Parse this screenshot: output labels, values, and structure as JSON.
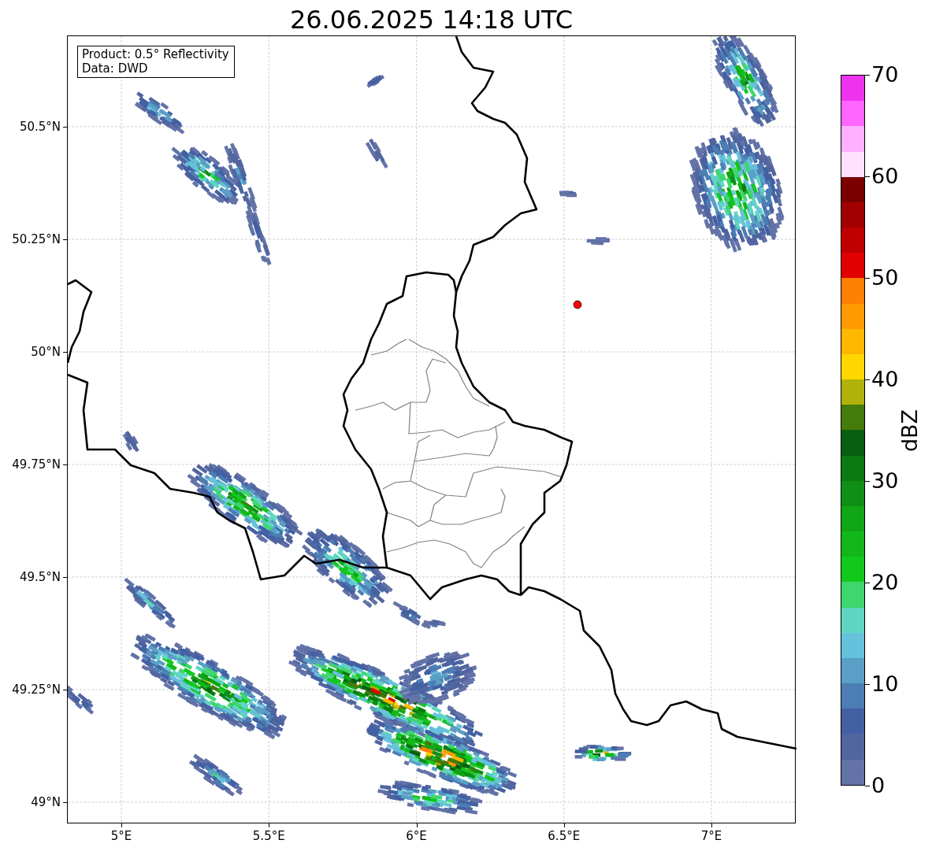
{
  "title": "26.06.2025 14:18 UTC",
  "info_box": [
    "Product: 0.5° Reflectivity",
    "Data: DWD"
  ],
  "y_ticks": [
    "50.5°N",
    "50.25°N",
    "50°N",
    "49.75°N",
    "49.5°N",
    "49.25°N",
    "49°N"
  ],
  "x_ticks": [
    "5°E",
    "5.5°E",
    "6°E",
    "6.5°E",
    "7°E"
  ],
  "colorbar": {
    "label": "dBZ",
    "ticks": [
      "70",
      "60",
      "50",
      "40",
      "30",
      "20",
      "10",
      "0"
    ],
    "colors": [
      {
        "color": "#ee33ee"
      },
      {
        "color": "#ff66ff"
      },
      {
        "color": "#ffb0ff"
      },
      {
        "color": "#ffe0ff"
      },
      {
        "color": "#7a0000"
      },
      {
        "color": "#a20000"
      },
      {
        "color": "#c00000"
      },
      {
        "color": "#e10000"
      },
      {
        "color": "#ff7f00"
      },
      {
        "color": "#ff9a00"
      },
      {
        "color": "#ffb700"
      },
      {
        "color": "#ffd700"
      },
      {
        "color": "#b1b209"
      },
      {
        "color": "#457a0c"
      },
      {
        "color": "#066010"
      },
      {
        "color": "#0b7a10"
      },
      {
        "color": "#0f8f15"
      },
      {
        "color": "#10a616"
      },
      {
        "color": "#12b81a"
      },
      {
        "color": "#12c81b"
      },
      {
        "color": "#3ed66e"
      },
      {
        "color": "#5fd5c3"
      },
      {
        "color": "#66c1dc"
      },
      {
        "color": "#5a9fc6"
      },
      {
        "color": "#4c7db3"
      },
      {
        "color": "#4360a3"
      },
      {
        "color": "#51659f"
      },
      {
        "color": "#6373a8"
      }
    ]
  }
}
